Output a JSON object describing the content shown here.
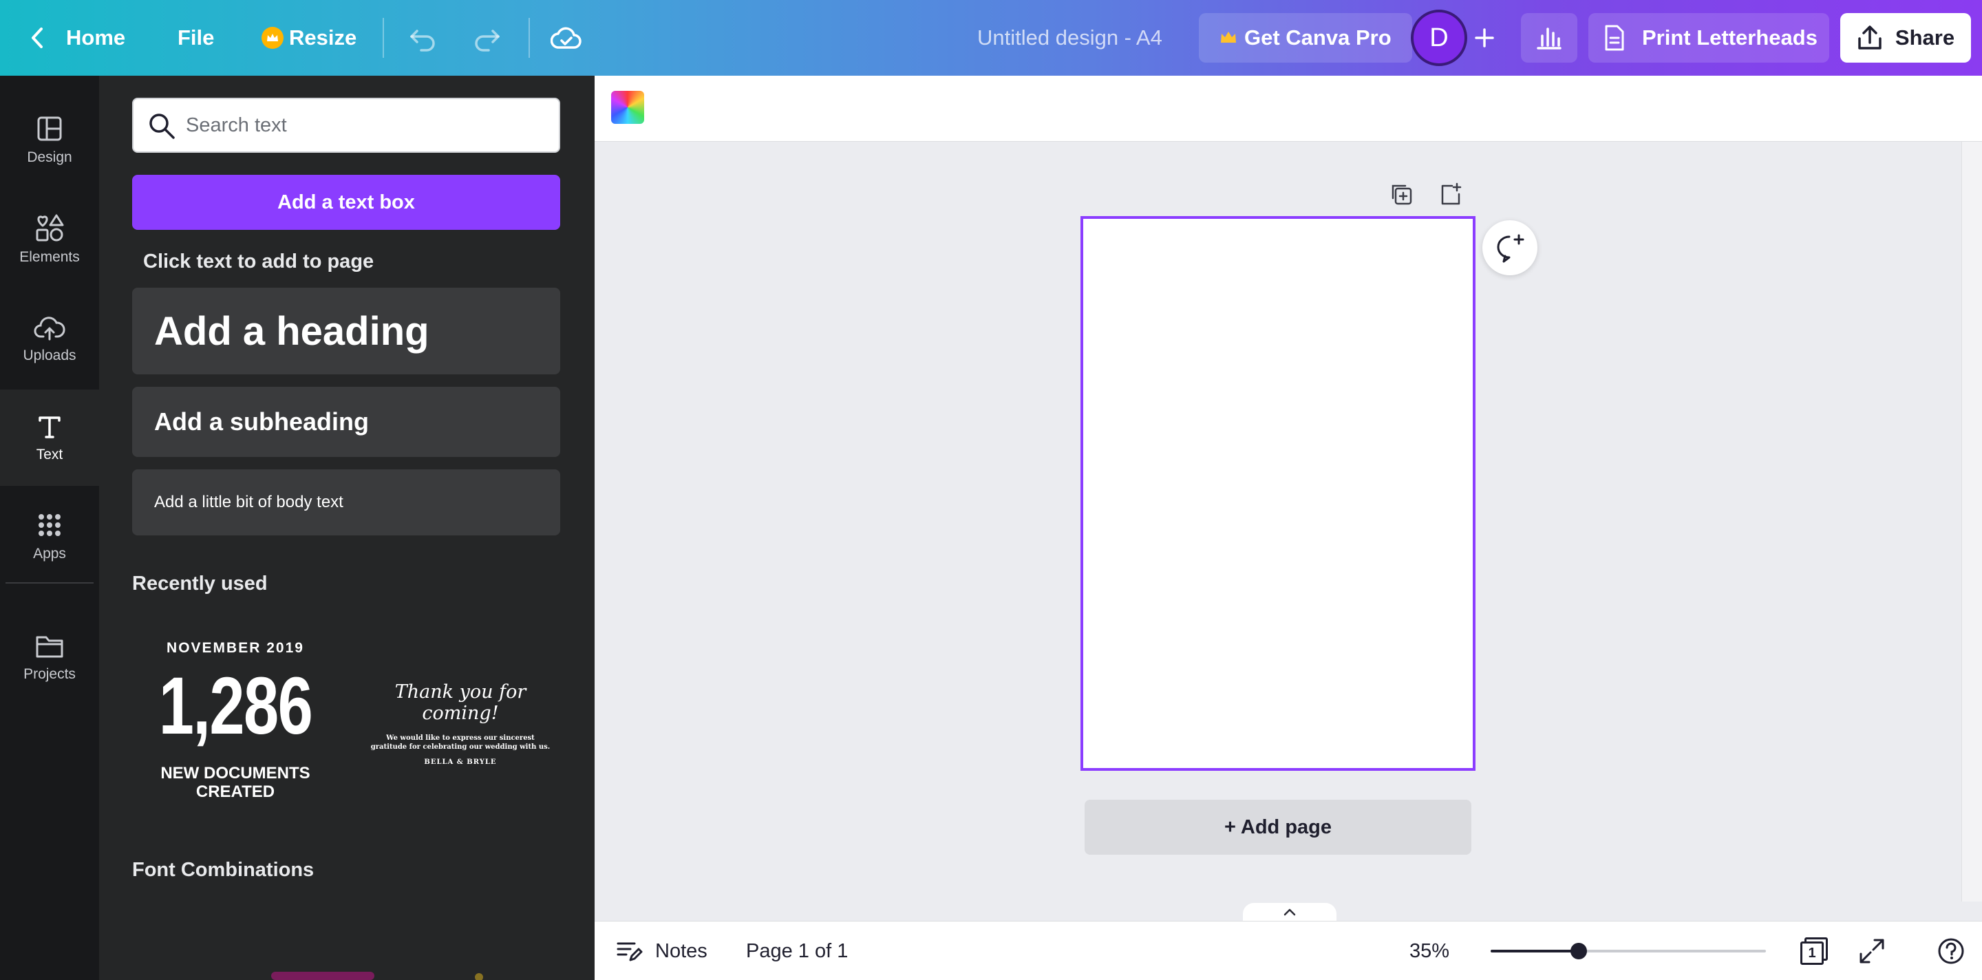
{
  "topbar": {
    "home_label": "Home",
    "file_label": "File",
    "resize_label": "Resize",
    "design_title": "Untitled design - A4",
    "get_pro_label": "Get Canva Pro",
    "avatar_initial": "D",
    "print_label": "Print Letterheads",
    "share_label": "Share"
  },
  "rail": {
    "items": [
      {
        "label": "Design",
        "icon": "layout-icon"
      },
      {
        "label": "Elements",
        "icon": "shapes-icon"
      },
      {
        "label": "Uploads",
        "icon": "cloud-upload-icon"
      },
      {
        "label": "Text",
        "icon": "text-icon"
      },
      {
        "label": "Apps",
        "icon": "apps-grid-icon"
      },
      {
        "label": "Projects",
        "icon": "folder-icon"
      }
    ],
    "active": "Text"
  },
  "panel": {
    "search_placeholder": "Search text",
    "add_textbox_label": "Add a text box",
    "click_hint": "Click text to add to page",
    "heading_label": "Add a heading",
    "subheading_label": "Add a subheading",
    "body_label": "Add a little bit of body text",
    "recently_used_title": "Recently used",
    "recent_1": {
      "date": "NOVEMBER 2019",
      "number": "1,286",
      "caption": "NEW DOCUMENTS CREATED"
    },
    "recent_2": {
      "title": "Thank you for coming!",
      "body": "We would like to express our sincerest gratitude for celebrating our wedding with us.",
      "names": "BELLA & BRYLE"
    },
    "font_combinations_title": "Font Combinations"
  },
  "canvas": {
    "add_page_label": "+ Add page",
    "accent_color": "#8b3dff"
  },
  "bottombar": {
    "notes_label": "Notes",
    "page_indicator": "Page 1 of 1",
    "zoom_label": "35%",
    "zoom_fraction": 0.32,
    "page_count": "1"
  }
}
